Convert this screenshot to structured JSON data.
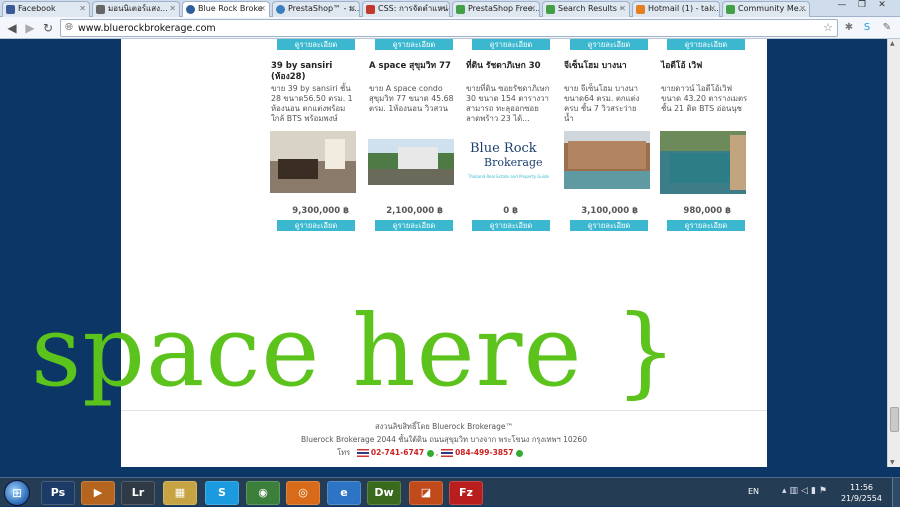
{
  "tabs": [
    {
      "title": "Facebook",
      "color": "#3b5998"
    },
    {
      "title": "มอนนิเตอร์แสง...",
      "color": "#666666"
    },
    {
      "title": "Blue Rock Broke",
      "color": "#2d5d9a",
      "active": true
    },
    {
      "title": "PrestaShop™ - ม...",
      "color": "#3b7fbf"
    },
    {
      "title": "CSS: การจัดตำแหน่ง",
      "color": "#c0392b"
    },
    {
      "title": "PrestaShop Free...",
      "color": "#43a047"
    },
    {
      "title": "Search Results ·",
      "color": "#43a047"
    },
    {
      "title": "Hotmail (1) - tai...",
      "color": "#e67e22"
    },
    {
      "title": "Community Me...",
      "color": "#43a047"
    }
  ],
  "address_bar": {
    "url": "www.bluerockbrokerage.com"
  },
  "products": {
    "button_label": "ดูรายละเอียด",
    "items": [
      {
        "title": "39 by sansiri (ห้อง28)",
        "desc": "ขาย 39 by sansiri ชั้น 28 ขนาด56.50 ตรม. 1 ห้องนอน ตกแต่งพร้อม ใกล้ BTS พร้อมพงษ์",
        "price": "9,300,000 ฿",
        "img_color": "#8a7a6a"
      },
      {
        "title": "A space สุขุมวิท 77",
        "desc": "ขาย A space condo สุขุมวิท 77  ขนาด 45.68 ตรม. 1ห้องนอน วิวสวน",
        "price": "2,100,000 ฿",
        "img_color": "#4d7a45"
      },
      {
        "title": "ที่ดิน รัชดาภิเษก 30",
        "desc": "ขายที่ดิน ซอยรัชดาภิเษก 30 ขนาด 154 ตารางวา สามารถ ทะลุออกซอย ลาดพร้าว 23 ได้...",
        "price": "0 ฿",
        "img_color": "#ffffff"
      },
      {
        "title": "จีเซ็นโฮม บางนา",
        "desc": "ขาย จีเซ็นโฮม บางนา ขนาด64 ตรม. ตกแต่งครบ ชั้น 7 วิวสระว่ายน้ำ",
        "price": "3,100,000 ฿",
        "img_color": "#9b6e4c"
      },
      {
        "title": "ไอดีโอ้ เวิฟ",
        "desc": "ขายดาวน์ ไอดีโอ้เวิฟ ขนาด 43.20 ตารางเมตร ชั้น 21 ติด BTS อ่อนนุช",
        "price": "980,000 ฿",
        "img_color": "#3d7d88"
      }
    ]
  },
  "logo": {
    "line1": "Blue Rock",
    "line2": "Brokerage",
    "tagline": "Thailand Real Estate and Property Guide"
  },
  "overlay_text": "space here }",
  "footer": {
    "copyright": "สงวนลิขสิทธิ์โดย Bluerock Brokerage™",
    "address": "Bluerock Brokerage 2044 ชั้นใต้ดิน ถนนสุขุมวิท บางจาก พระโขนง กรุงเทพฯ 10260",
    "phone_label": "โทร",
    "phone1": "02-741-6747",
    "phone2": "084-499-3857"
  },
  "taskbar": {
    "apps": [
      {
        "name": "photoshop",
        "label": "Ps",
        "color": "#1b3a66"
      },
      {
        "name": "media",
        "label": "▶",
        "color": "#b5651d"
      },
      {
        "name": "lightroom",
        "label": "Lr",
        "color": "#2f3a46"
      },
      {
        "name": "explorer",
        "label": "▦",
        "color": "#c7a443"
      },
      {
        "name": "skype",
        "label": "S",
        "color": "#1c9ae0"
      },
      {
        "name": "chrome",
        "label": "◉",
        "color": "#3b7f3b"
      },
      {
        "name": "firefox",
        "label": "◎",
        "color": "#d86b1a"
      },
      {
        "name": "ie",
        "label": "e",
        "color": "#2d74c4"
      },
      {
        "name": "dreamweaver",
        "label": "Dw",
        "color": "#3a6a1e"
      },
      {
        "name": "powerpoint",
        "label": "◪",
        "color": "#c04a1a"
      },
      {
        "name": "filezilla",
        "label": "Fz",
        "color": "#b81e1e"
      }
    ],
    "lang": "EN",
    "time": "11:56",
    "date": "21/9/2554"
  }
}
